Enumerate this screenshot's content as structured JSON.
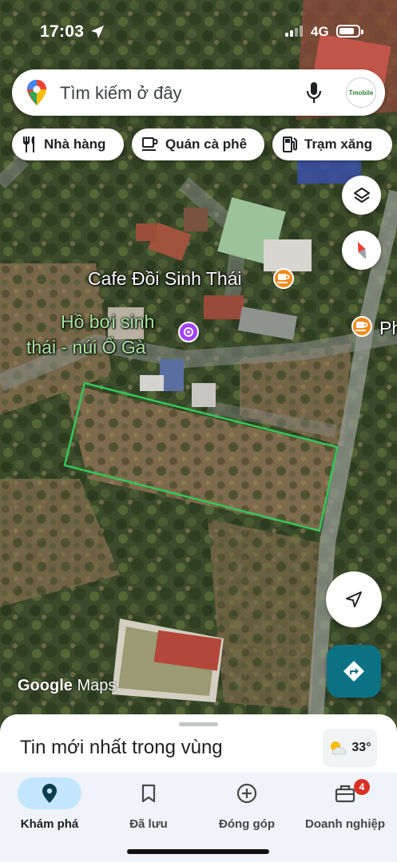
{
  "status_bar": {
    "time": "17:03",
    "network": "4G"
  },
  "search": {
    "placeholder": "Tìm kiếm ở đây",
    "avatar_text": "Tmobile"
  },
  "chips": [
    {
      "label": "Nhà hàng",
      "icon": "restaurant-icon"
    },
    {
      "label": "Quán cà phê",
      "icon": "coffee-icon"
    },
    {
      "label": "Trạm xăng",
      "icon": "gas-station-icon"
    }
  ],
  "map": {
    "labels": {
      "cafe": "Cafe Đồi Sinh Thái",
      "pool_line1": "Hồ bơi sinh",
      "pool_line2": "thái - núi Ổ Gà",
      "cafe_edge": "Ph"
    },
    "attribution_google": "Google",
    "attribution_maps": "Maps",
    "colors": {
      "cafe_marker": "#f28b1d",
      "pool_marker": "#a142f4",
      "boundary": "#34c759",
      "directions": "#0b7285"
    }
  },
  "bottom_sheet": {
    "title": "Tin mới nhất trong vùng",
    "weather": "33°"
  },
  "nav": {
    "items": [
      {
        "label": "Khám phá",
        "icon": "explore-pin-icon",
        "active": true
      },
      {
        "label": "Đã lưu",
        "icon": "bookmark-icon"
      },
      {
        "label": "Đóng góp",
        "icon": "add-circle-icon"
      },
      {
        "label": "Doanh nghiệp",
        "icon": "business-icon",
        "badge": "4"
      }
    ]
  }
}
